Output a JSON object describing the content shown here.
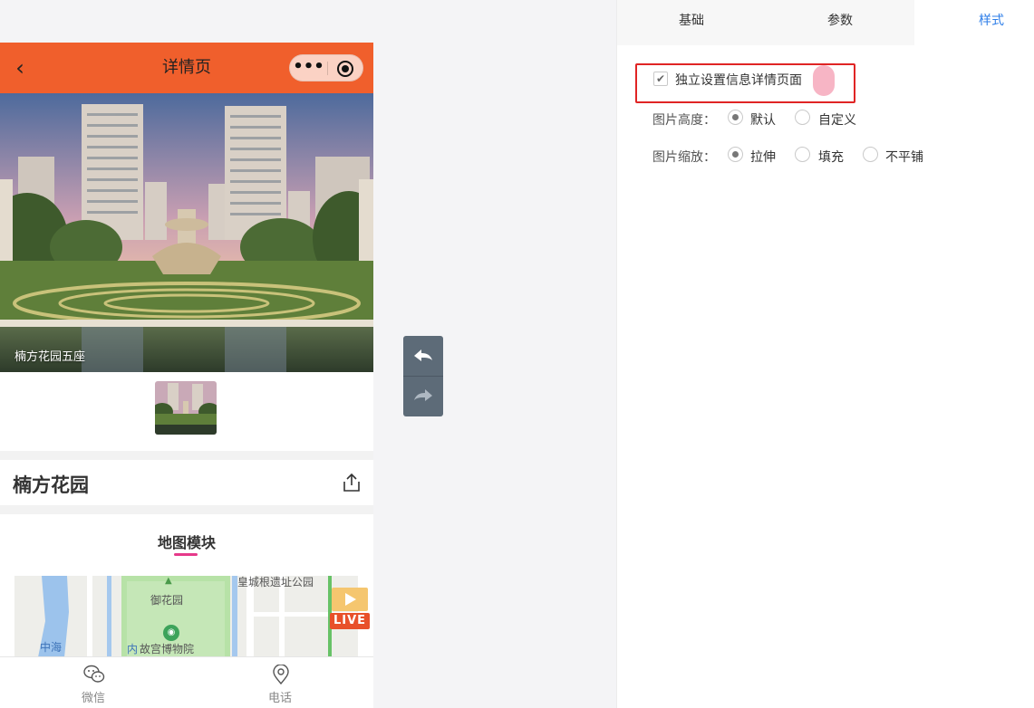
{
  "phone": {
    "nav": {
      "back_icon": "‹",
      "title": "详情页",
      "more_icon": "•••"
    },
    "hero_caption": "楠方花园五座",
    "property_title": "楠方花园",
    "map_section": {
      "heading": "地图模块",
      "labels": [
        "御花园",
        "皇城根遗址公园",
        "中海",
        "内",
        "故宫博物院"
      ],
      "live_badge": "LIVE"
    },
    "bottom_bar": [
      {
        "label": "微信",
        "icon": "wechat-icon"
      },
      {
        "label": "电话",
        "icon": "location-pin-icon"
      }
    ]
  },
  "history": {
    "undo_icon": "undo-icon",
    "redo_icon": "redo-icon"
  },
  "panel": {
    "tabs": [
      {
        "label": "基础",
        "active": false
      },
      {
        "label": "参数",
        "active": false
      },
      {
        "label": "样式",
        "active": true
      }
    ],
    "independent_checkbox": {
      "label": "独立设置信息详情页面",
      "checked": true,
      "mark": "✔"
    },
    "image_height": {
      "label": "图片高度：",
      "options": [
        {
          "label": "默认",
          "selected": true
        },
        {
          "label": "自定义",
          "selected": false
        }
      ]
    },
    "image_scale": {
      "label": "图片缩放：",
      "options": [
        {
          "label": "拉伸",
          "selected": true
        },
        {
          "label": "填充",
          "selected": false
        },
        {
          "label": "不平铺",
          "selected": false
        }
      ]
    }
  },
  "colors": {
    "nav_bg": "#f05f2c",
    "active_tab": "#2d7ee8",
    "highlight_border": "#e02424",
    "map_underline": "#e6398a",
    "history_bg": "#5d6b78"
  }
}
